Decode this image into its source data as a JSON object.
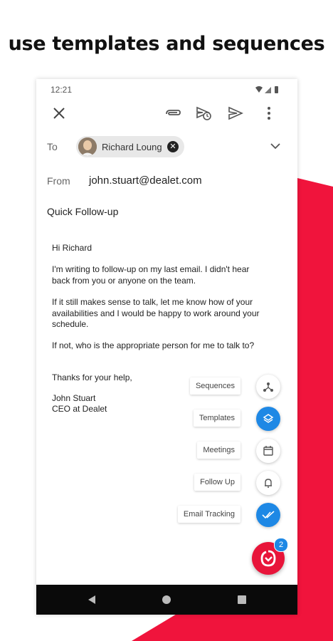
{
  "headline": "use templates and sequences",
  "status_bar": {
    "time": "12:21"
  },
  "compose": {
    "to_label": "To",
    "recipient": "Richard Loung",
    "from_label": "From",
    "from_value": "john.stuart@dealet.com",
    "subject": "Quick Follow-up",
    "body": {
      "greeting": "Hi Richard",
      "p1": "I'm writing to follow-up on my last email. I didn't hear back from you or anyone on the team.",
      "p2": "If it still makes sense to talk, let me know how of your availabilities and I would be happy to work around your schedule.",
      "p3": "If not, who is the appropriate person for me to talk to?",
      "closing": "Thanks for your help,",
      "sig_name": "John Stuart",
      "sig_title": "CEO at Dealet"
    }
  },
  "fab_menu": [
    {
      "label": "Sequences",
      "icon": "sequences-icon",
      "style": "white"
    },
    {
      "label": "Templates",
      "icon": "layers-icon",
      "style": "blue"
    },
    {
      "label": "Meetings",
      "icon": "calendar-icon",
      "style": "white"
    },
    {
      "label": "Follow Up",
      "icon": "bell-icon",
      "style": "white"
    },
    {
      "label": "Email Tracking",
      "icon": "double-check-icon",
      "style": "blue"
    }
  ],
  "main_fab": {
    "badge": "2",
    "icon": "dealet-logo-icon"
  },
  "colors": {
    "accent_red": "#e8153a",
    "accent_blue": "#1e88e5",
    "nav_bar": "#0a0a0a"
  }
}
